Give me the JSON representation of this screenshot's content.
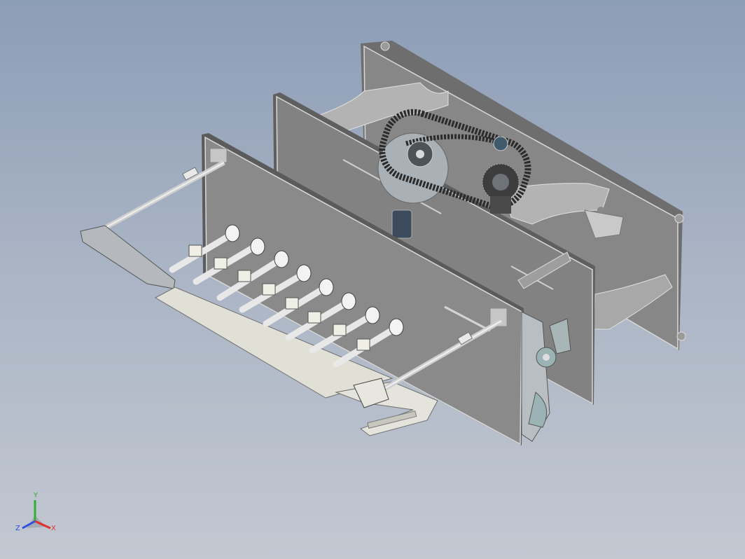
{
  "viewport": {
    "colors": {
      "background_top": "#8c9db6",
      "background_bottom": "#c3c8d1",
      "plate": "#7f7f7f",
      "plate_edge": "#d9d9d9",
      "tray": "#dcdcd3",
      "rod": "#e6e6e6",
      "chain": "#2b2b2b",
      "bracket": "#b4b8bb",
      "accent_part": "#9bb3b4"
    }
  },
  "triad": {
    "x_label": "X",
    "y_label": "Y",
    "z_label": "Z",
    "colors": {
      "x": "#e03030",
      "y": "#30b030",
      "z": "#3050e0"
    }
  }
}
